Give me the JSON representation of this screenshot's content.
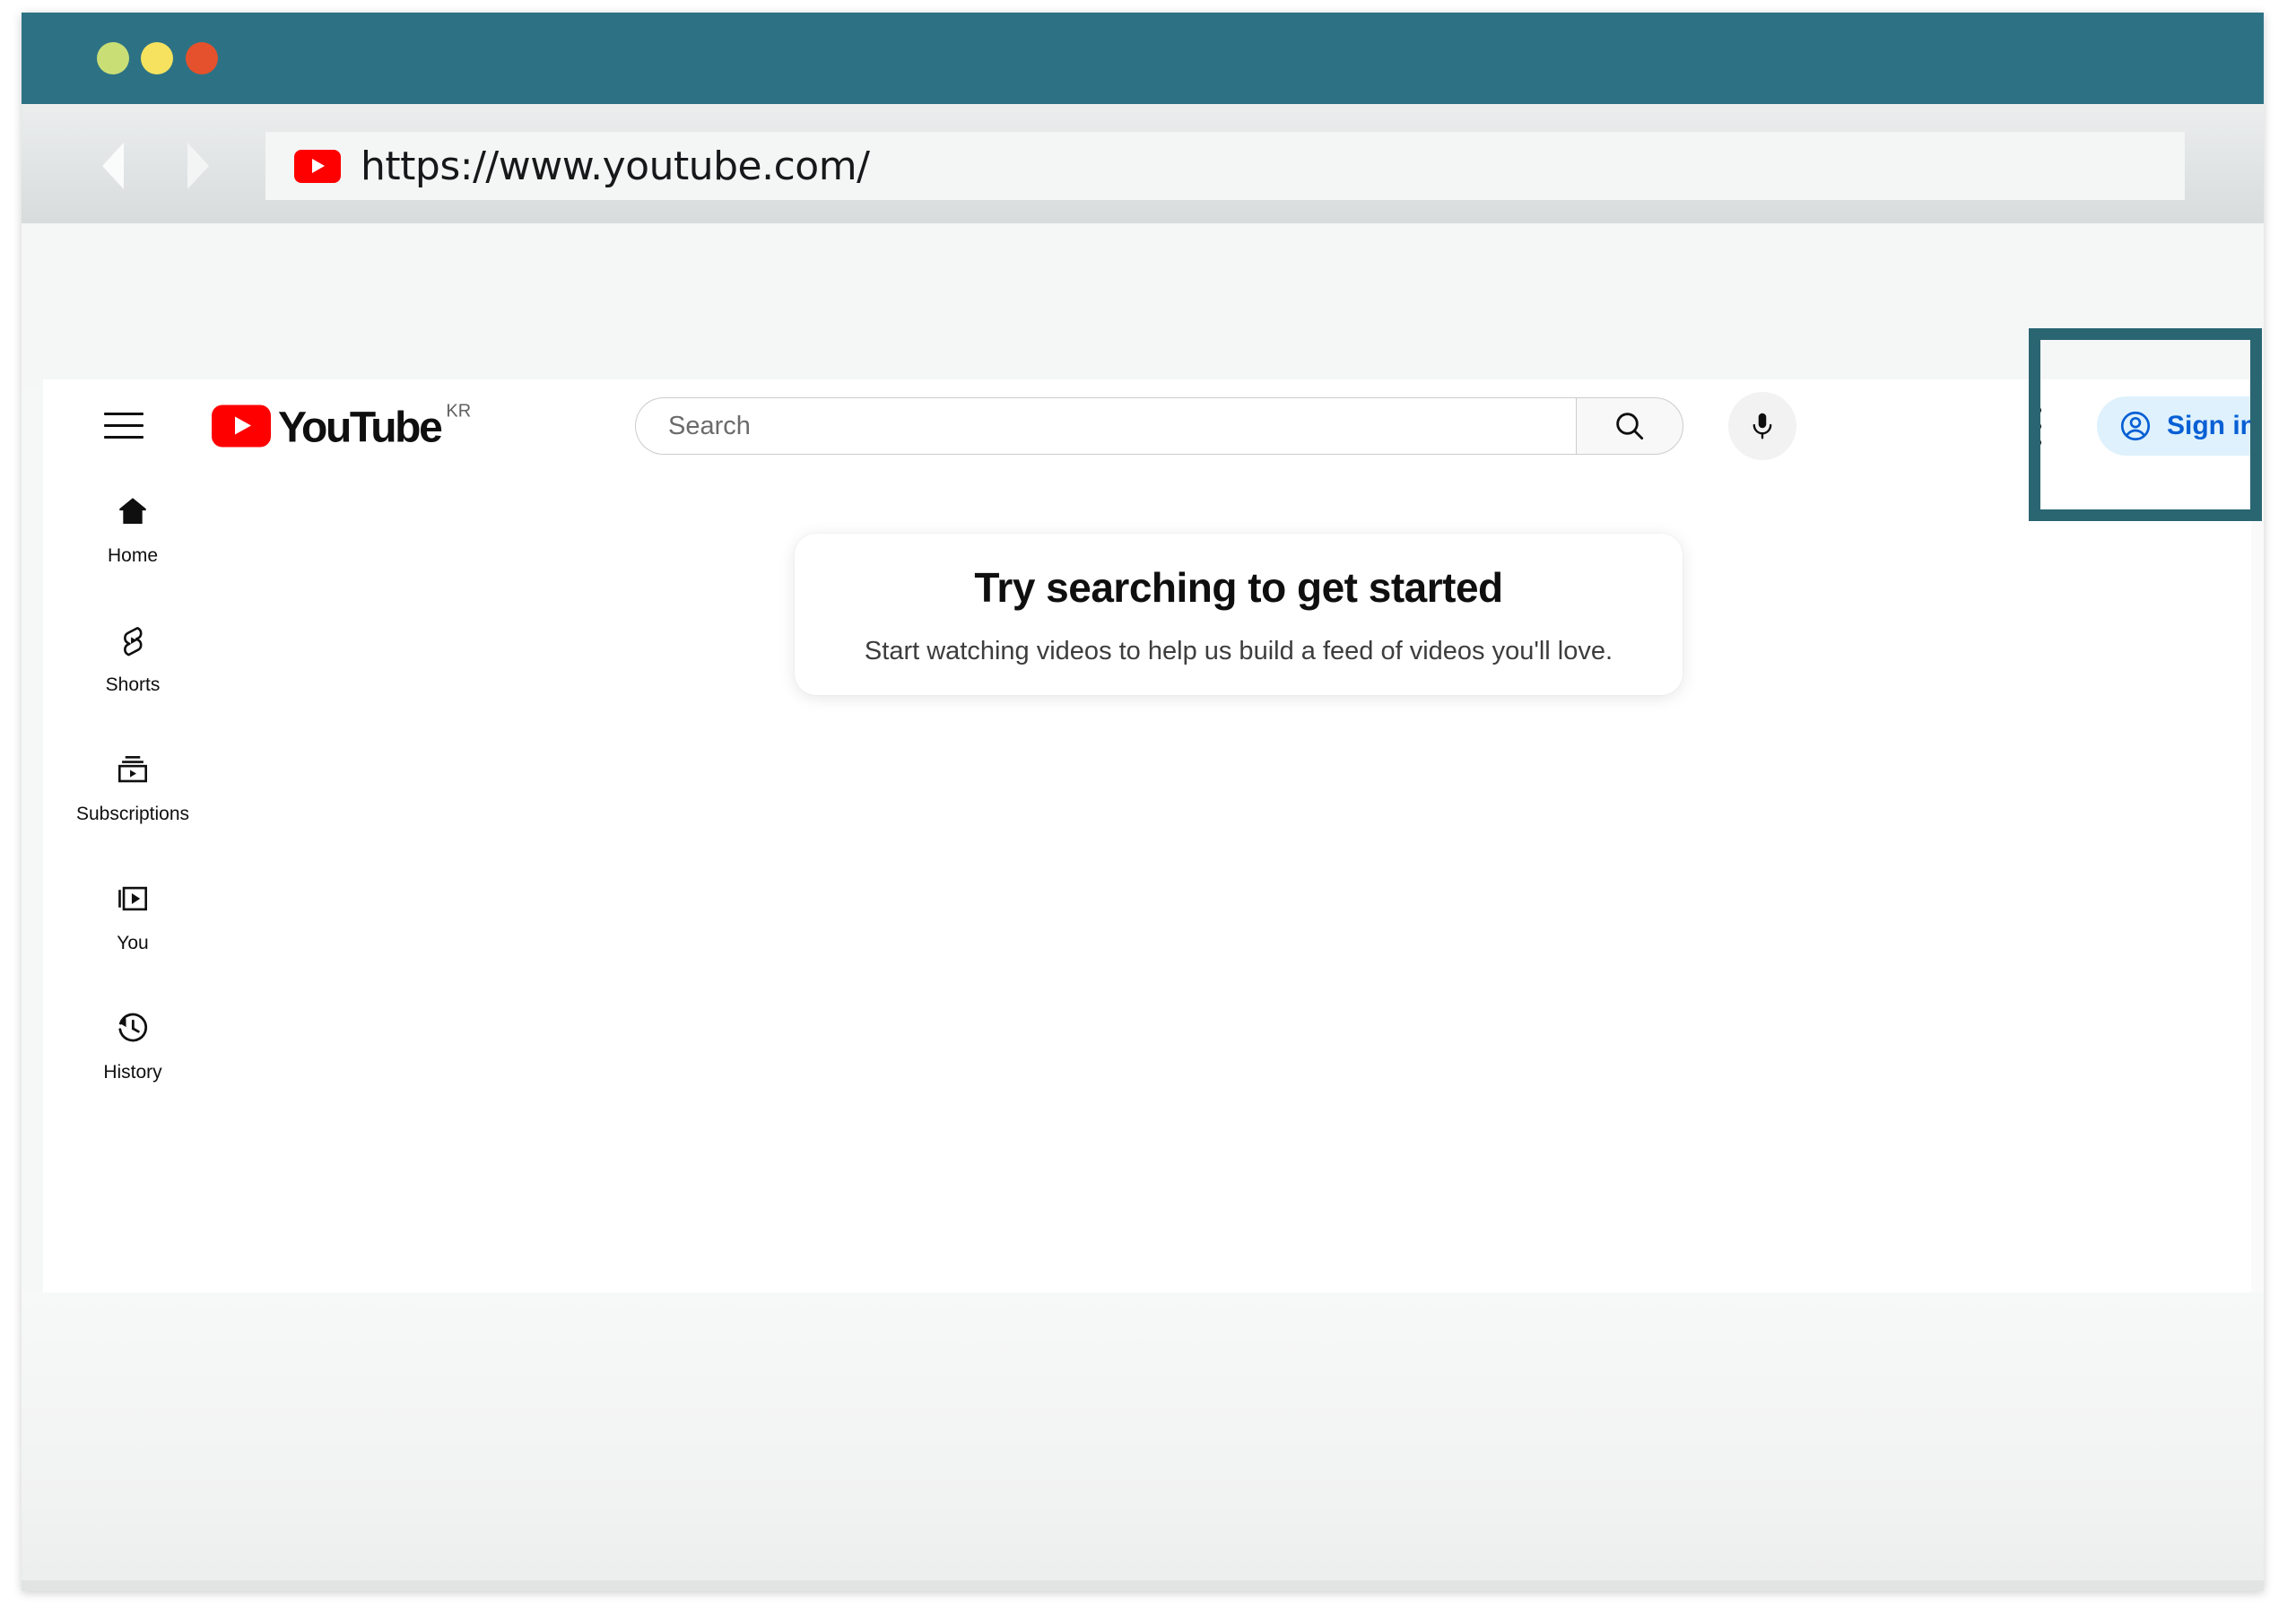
{
  "window": {
    "title_bar": {
      "color": "#2d7284"
    },
    "traffic_lights": [
      {
        "name": "close",
        "color": "#c9df76"
      },
      {
        "name": "minimize",
        "color": "#f6e25e"
      },
      {
        "name": "maximize",
        "color": "#e5512c"
      }
    ]
  },
  "toolbar": {
    "back_label": "Back",
    "forward_label": "Forward",
    "url": "https://www.youtube.com/",
    "favicon": "youtube-favicon"
  },
  "youtube": {
    "logo": {
      "word": "YouTube",
      "country_code": "KR"
    },
    "menu_icon": "hamburger-icon",
    "search": {
      "placeholder": "Search",
      "value": "",
      "search_icon": "search-icon",
      "mic_icon": "microphone-icon"
    },
    "kebab_icon": "more-vertical-icon",
    "sign_in": {
      "label": "Sign in",
      "icon": "account-circle-icon",
      "background": "#def1fd",
      "text_color": "#065fd4"
    },
    "sidebar": {
      "items": [
        {
          "label": "Home",
          "icon": "home-icon"
        },
        {
          "label": "Shorts",
          "icon": "shorts-icon"
        },
        {
          "label": "Subscriptions",
          "icon": "subscriptions-icon"
        },
        {
          "label": "You",
          "icon": "you-library-icon"
        },
        {
          "label": "History",
          "icon": "history-clock-icon"
        }
      ]
    },
    "empty_state": {
      "title": "Try searching to get started",
      "subtitle": "Start watching videos to help us build a feed of videos you'll love."
    }
  },
  "annotation": {
    "target": "sign-in-button",
    "color": "#2a6572"
  }
}
